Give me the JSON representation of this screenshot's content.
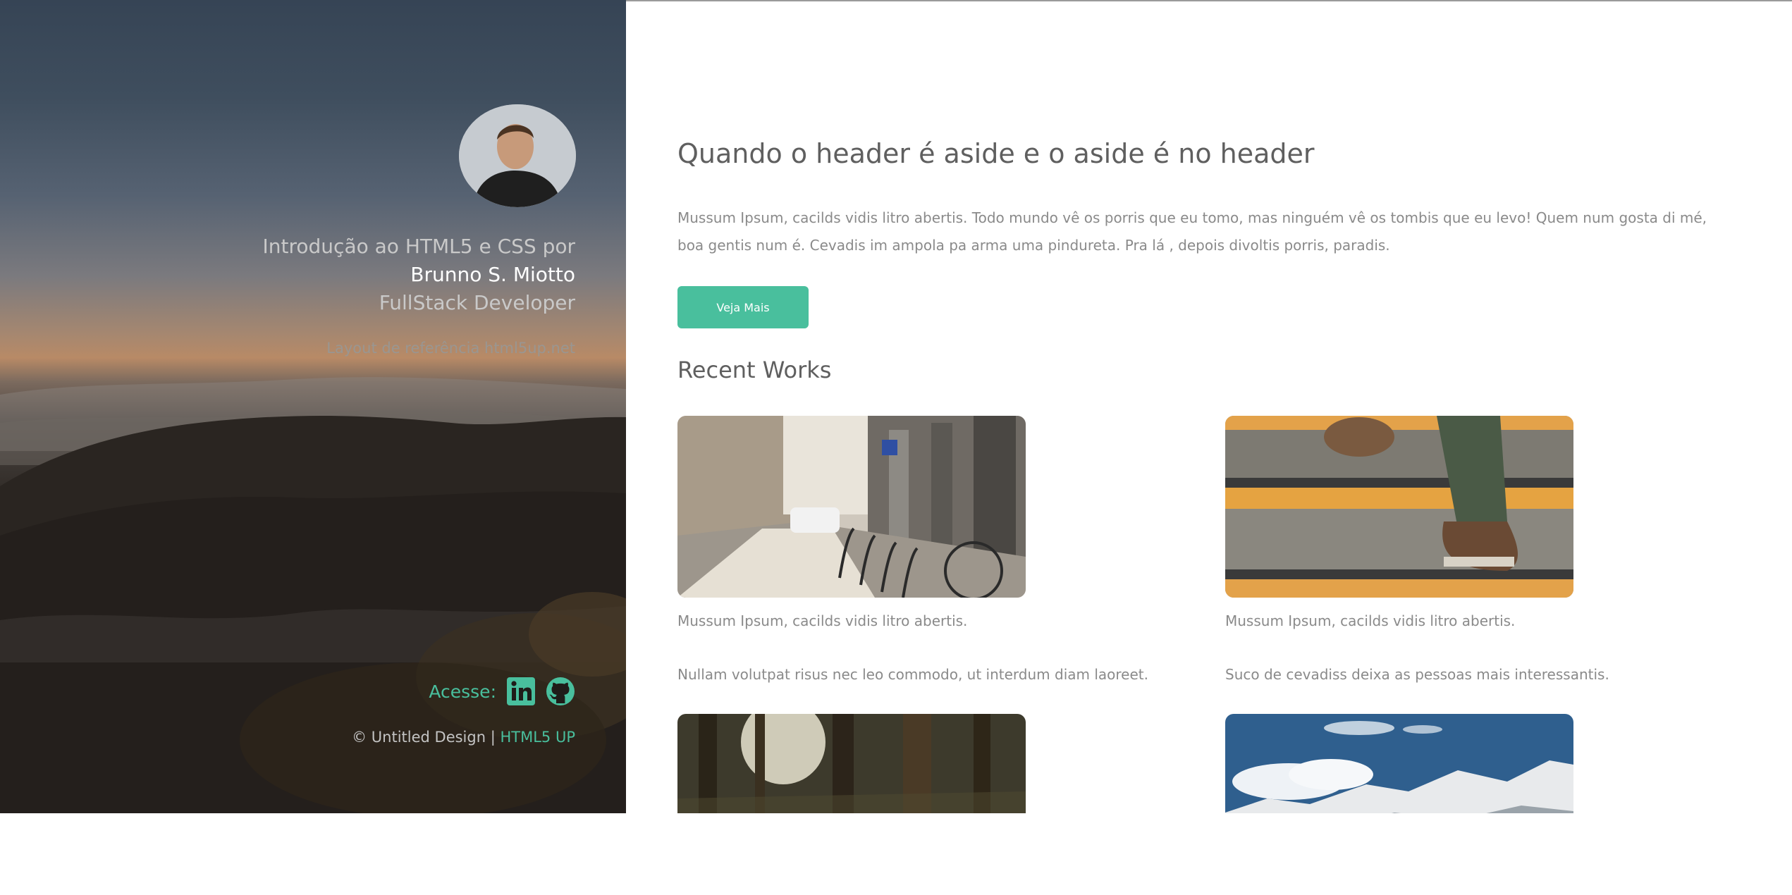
{
  "sidebar": {
    "intro_prefix": "Introdução ao HTML5 e CSS por",
    "author_name": "Brunno S. Miotto",
    "author_role": "FullStack Developer",
    "reference": "Layout de referência html5up.net",
    "access_label": "Acesse:",
    "social": [
      {
        "name": "linkedin-icon"
      },
      {
        "name": "github-icon"
      }
    ],
    "footer_copyright": "© Untitled Design |",
    "footer_link": "HTML5 UP"
  },
  "main": {
    "headline": "Quando o header é aside e o aside é no header",
    "lead": "Mussum Ipsum, cacilds vidis litro abertis. Todo mundo vê os porris que eu tomo, mas ninguém vê os tombis que eu levo! Quem num gosta di mé, boa gentis num é. Cevadis im ampola pa arma uma pindureta. Pra lá , depois divoltis porris, paradis.",
    "cta_label": "Veja Mais",
    "section_title": "Recent Works",
    "works": [
      {
        "caption": "Mussum Ipsum, cacilds vidis litro abertis.",
        "desc": "Nullam volutpat risus nec leo commodo, ut interdum diam laoreet."
      },
      {
        "caption": "Mussum Ipsum, cacilds vidis litro abertis.",
        "desc": "Suco de cevadiss deixa as pessoas mais interessantis."
      },
      {
        "caption": "",
        "desc": ""
      },
      {
        "caption": "",
        "desc": ""
      }
    ]
  },
  "colors": {
    "accent": "#49bf9d",
    "text": "#8a8a8a",
    "heading": "#5f5f5f"
  }
}
